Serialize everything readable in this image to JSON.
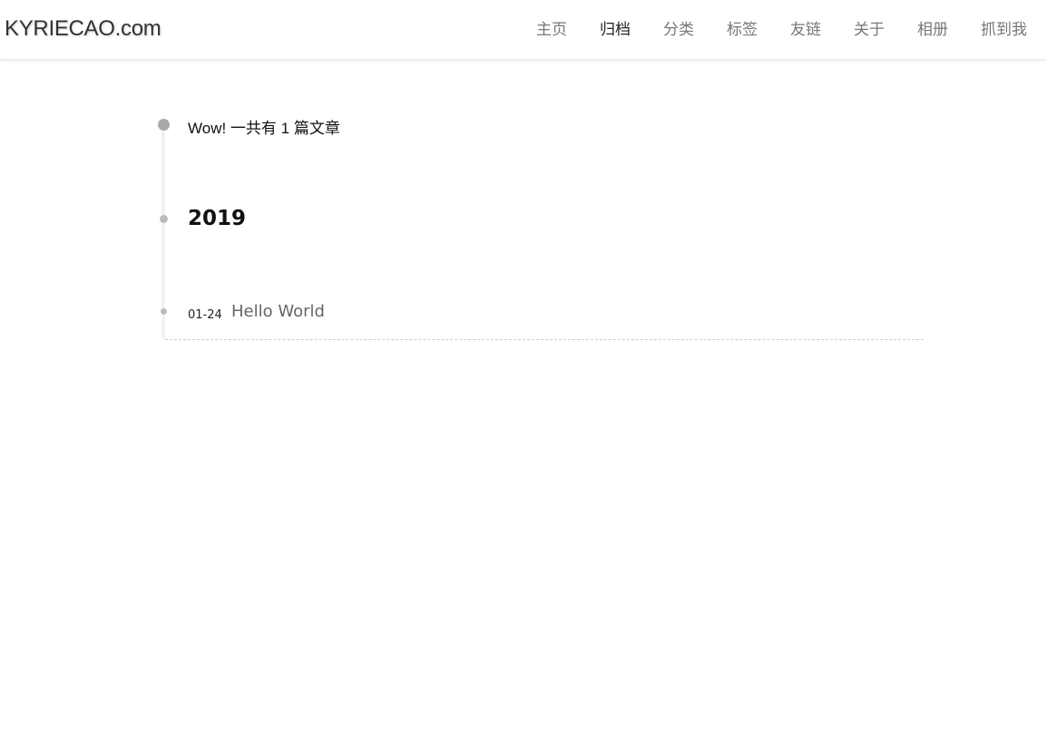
{
  "header": {
    "site_title": "KYRIECAO.com",
    "nav": [
      {
        "label": "主页",
        "active": false
      },
      {
        "label": "归档",
        "active": true
      },
      {
        "label": "分类",
        "active": false
      },
      {
        "label": "标签",
        "active": false
      },
      {
        "label": "友链",
        "active": false
      },
      {
        "label": "关于",
        "active": false
      },
      {
        "label": "相册",
        "active": false
      },
      {
        "label": "抓到我",
        "active": false
      }
    ]
  },
  "archive": {
    "count_text": "Wow! 一共有 1 篇文章",
    "years": [
      {
        "year": "2019",
        "posts": [
          {
            "date": "01-24",
            "title": "Hello World"
          }
        ]
      }
    ]
  },
  "colors": {
    "nav_text": "#777777",
    "nav_active": "#222222",
    "post_title": "#666666",
    "timeline": "#f2f2f2"
  }
}
